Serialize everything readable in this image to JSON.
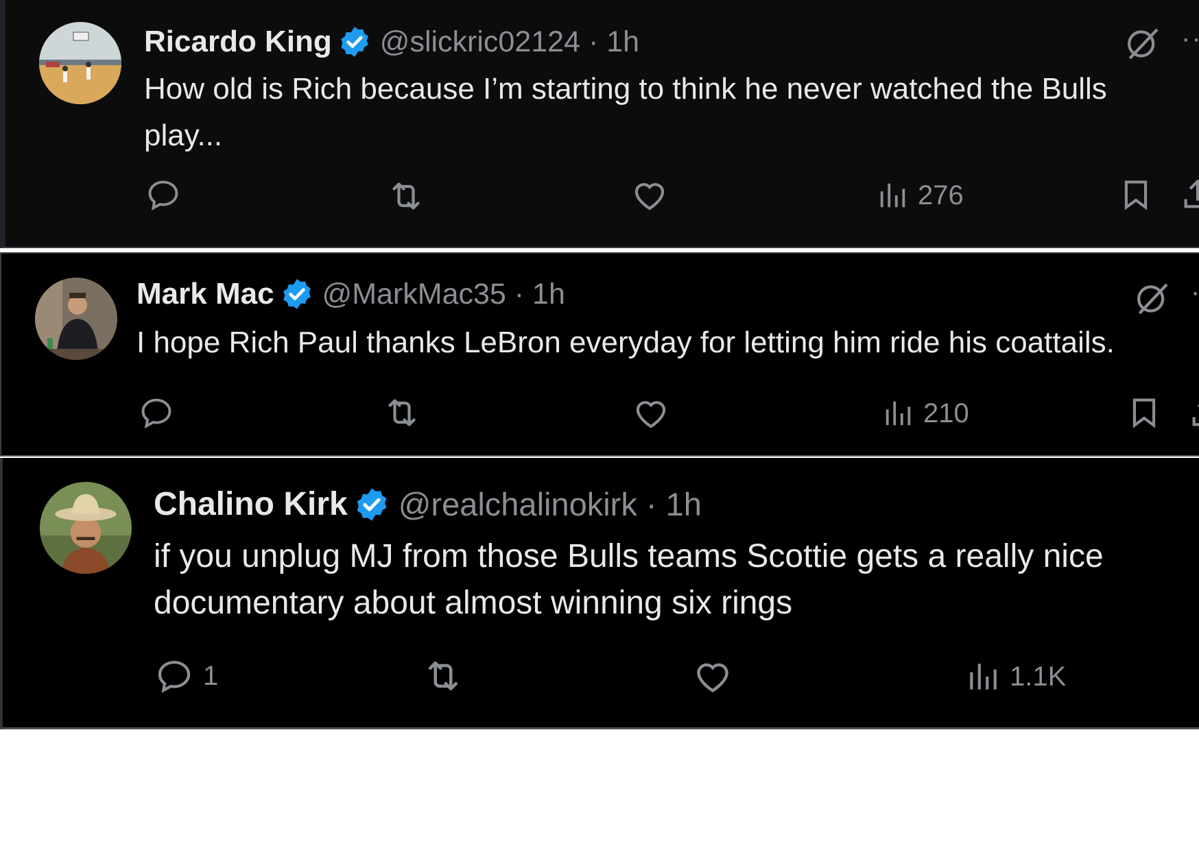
{
  "tweets": [
    {
      "name": "Ricardo King",
      "handle": "@slickric02124 · 1h",
      "text_lines": [
        "How old is Rich because I’m starting to think he never watched the Bulls",
        "play..."
      ],
      "replies": "",
      "views": "276"
    },
    {
      "name": "Mark Mac",
      "handle": "@MarkMac35 · 1h",
      "text_lines": [
        "I hope Rich Paul thanks LeBron everyday for letting him ride his coattails."
      ],
      "replies": "",
      "views": "210"
    },
    {
      "name": "Chalino Kirk",
      "handle": "@realchalinokirk · 1h",
      "text_lines": [
        "if you unplug MJ from those Bulls teams Scottie gets a really nice",
        "documentary about almost winning six rings"
      ],
      "replies": "1",
      "views": "1.1K"
    }
  ],
  "icons": {
    "reply": "reply-icon",
    "retweet": "retweet-icon",
    "like": "like-icon",
    "views": "views-icon",
    "bookmark": "bookmark-icon",
    "share": "share-icon",
    "grok": "grok-icon",
    "more": "more-icon",
    "verified": "verified-badge-icon"
  },
  "colors": {
    "verified": "#1d9bf0",
    "background": "#000000",
    "muted": "#8b8f94",
    "text": "#e7e9ea"
  }
}
